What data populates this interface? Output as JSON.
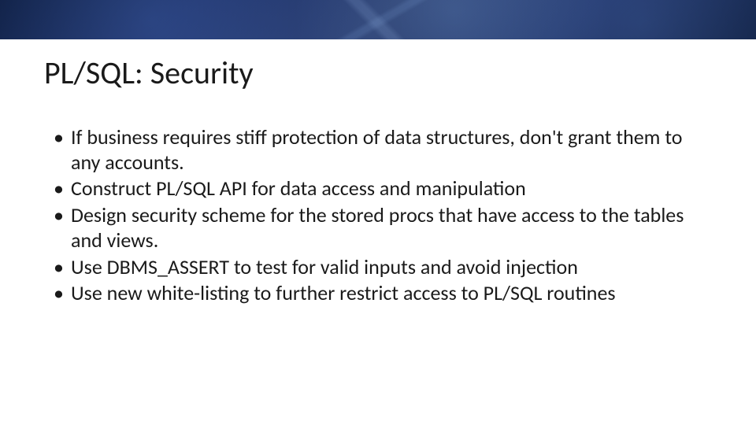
{
  "slide": {
    "title": "PL/SQL: Security",
    "bullets": [
      "If business requires stiff protection of data structures, don't grant them to any accounts.",
      "Construct PL/SQL API for data access and manipulation",
      "Design security scheme for the stored procs that have access to the tables and views.",
      "Use DBMS_ASSERT to test for valid inputs and avoid injection",
      "Use new white-listing to further restrict access to PL/SQL routines"
    ]
  }
}
